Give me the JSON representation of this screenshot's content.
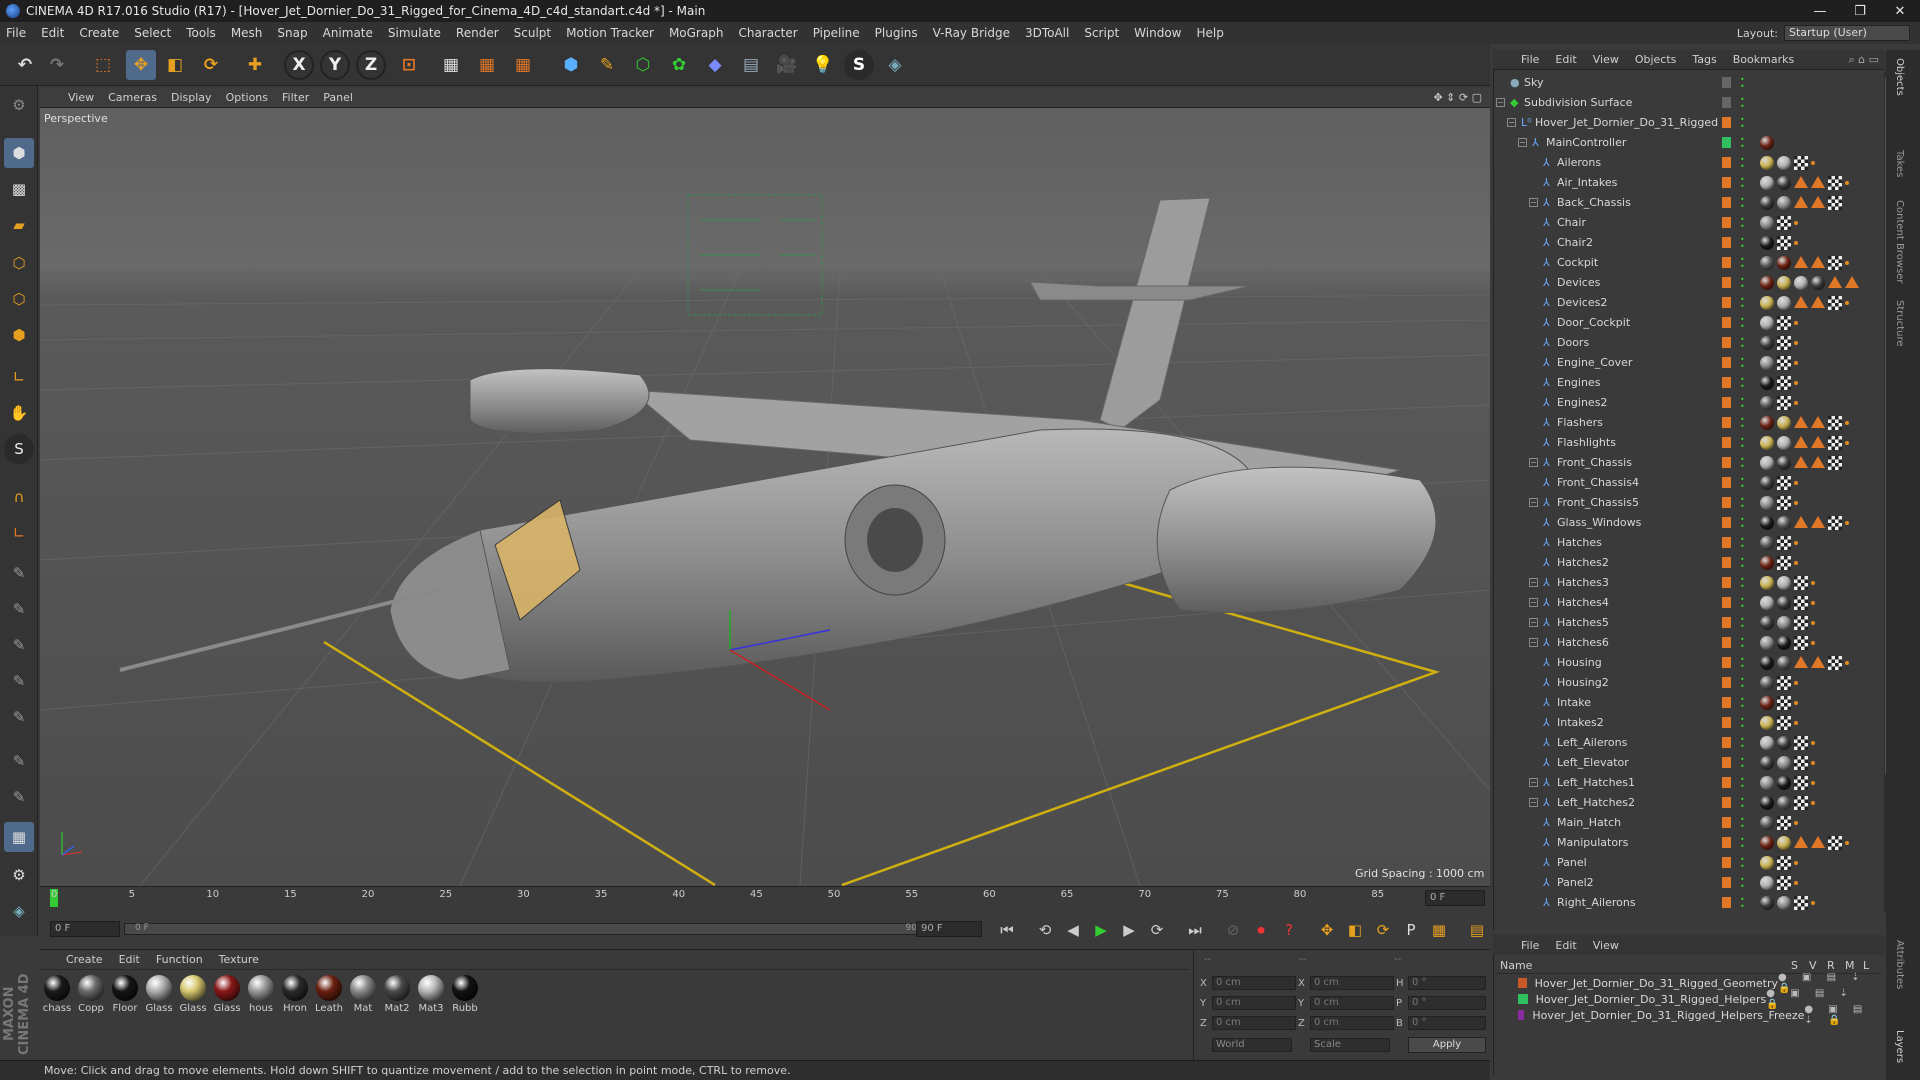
{
  "window": {
    "title": "CINEMA 4D R17.016 Studio (R17) - [Hover_Jet_Dornier_Do_31_Rigged_for_Cinema_4D_c4d_standart.c4d *] - Main"
  },
  "menubar": {
    "items": [
      "File",
      "Edit",
      "Create",
      "Select",
      "Tools",
      "Mesh",
      "Snap",
      "Animate",
      "Simulate",
      "Render",
      "Sculpt",
      "Motion Tracker",
      "MoGraph",
      "Character",
      "Pipeline",
      "Plugins",
      "V-Ray Bridge",
      "3DToAll",
      "Script",
      "Window",
      "Help"
    ],
    "layout_label": "Layout:",
    "layout_value": "Startup (User)"
  },
  "viewport": {
    "menu": [
      "View",
      "Cameras",
      "Display",
      "Options",
      "Filter",
      "Panel"
    ],
    "label": "Perspective",
    "grid_spacing": "Grid Spacing : 1000 cm"
  },
  "timeline": {
    "ticks": [
      "0",
      "5",
      "10",
      "15",
      "20",
      "25",
      "30",
      "35",
      "40",
      "45",
      "50",
      "55",
      "60",
      "65",
      "70",
      "75",
      "80",
      "85",
      "90"
    ],
    "end_frame": "0 F"
  },
  "transport": {
    "start": "0 F",
    "range_start": "0 F",
    "range_end": "90 F",
    "end": "90 F"
  },
  "materials": {
    "menu": [
      "Create",
      "Edit",
      "Function",
      "Texture"
    ],
    "items": [
      {
        "label": "chass",
        "color": "#1a1a1a"
      },
      {
        "label": "Copp",
        "color": "#6a6a6a"
      },
      {
        "label": "Floor",
        "color": "#151515"
      },
      {
        "label": "Glass",
        "color": "#b0b0b0"
      },
      {
        "label": "Glass",
        "color": "#d8c870"
      },
      {
        "label": "Glass",
        "color": "#8a1818"
      },
      {
        "label": "hous",
        "color": "#9a9a9a"
      },
      {
        "label": "Hron",
        "color": "#2a2a2a"
      },
      {
        "label": "Leath",
        "color": "#6a2010"
      },
      {
        "label": "Mat",
        "color": "#8a8a8a"
      },
      {
        "label": "Mat2",
        "color": "#4a4a4a"
      },
      {
        "label": "Mat3",
        "color": "#b8b8b8"
      },
      {
        "label": "Rubb",
        "color": "#111111"
      }
    ]
  },
  "coords": {
    "x_pos": "0 cm",
    "y_pos": "0 cm",
    "z_pos": "0 cm",
    "x_size": "0 cm",
    "y_size": "0 cm",
    "z_size": "0 cm",
    "h_rot": "0 °",
    "p_rot": "0 °",
    "b_rot": "0 °",
    "mode1": "World",
    "mode2": "Scale",
    "apply": "Apply",
    "lbl_x": "X",
    "lbl_y": "Y",
    "lbl_z": "Z",
    "lbl_h": "H",
    "lbl_p": "P",
    "lbl_b": "B",
    "top1": "--",
    "top2": "--",
    "top3": "--"
  },
  "status": "Move: Click and drag to move elements. Hold down SHIFT to quantize movement / add to the selection in point mode, CTRL to remove.",
  "object_manager": {
    "menu": [
      "File",
      "Edit",
      "View",
      "Objects",
      "Tags",
      "Bookmarks"
    ],
    "objects": [
      {
        "name": "Sky",
        "indent": 0,
        "expand": false,
        "icon": "sky"
      },
      {
        "name": "Subdivision Surface",
        "indent": 0,
        "expand": true,
        "icon": "subd"
      },
      {
        "name": "Hover_Jet_Dornier_Do_31_Rigged",
        "indent": 1,
        "expand": true,
        "icon": "null"
      },
      {
        "name": "MainController",
        "indent": 2,
        "expand": true,
        "icon": "bone"
      },
      {
        "name": "Ailerons",
        "indent": 3,
        "expand": false,
        "icon": "bone"
      },
      {
        "name": "Air_Intakes",
        "indent": 3,
        "expand": false,
        "icon": "bone"
      },
      {
        "name": "Back_Chassis",
        "indent": 3,
        "expand": true,
        "icon": "bone"
      },
      {
        "name": "Chair",
        "indent": 3,
        "expand": false,
        "icon": "bone"
      },
      {
        "name": "Chair2",
        "indent": 3,
        "expand": false,
        "icon": "bone"
      },
      {
        "name": "Cockpit",
        "indent": 3,
        "expand": false,
        "icon": "bone"
      },
      {
        "name": "Devices",
        "indent": 3,
        "expand": false,
        "icon": "bone"
      },
      {
        "name": "Devices2",
        "indent": 3,
        "expand": false,
        "icon": "bone"
      },
      {
        "name": "Door_Cockpit",
        "indent": 3,
        "expand": false,
        "icon": "bone"
      },
      {
        "name": "Doors",
        "indent": 3,
        "expand": false,
        "icon": "bone"
      },
      {
        "name": "Engine_Cover",
        "indent": 3,
        "expand": false,
        "icon": "bone"
      },
      {
        "name": "Engines",
        "indent": 3,
        "expand": false,
        "icon": "bone"
      },
      {
        "name": "Engines2",
        "indent": 3,
        "expand": false,
        "icon": "bone"
      },
      {
        "name": "Flashers",
        "indent": 3,
        "expand": false,
        "icon": "bone"
      },
      {
        "name": "Flashlights",
        "indent": 3,
        "expand": false,
        "icon": "bone"
      },
      {
        "name": "Front_Chassis",
        "indent": 3,
        "expand": true,
        "icon": "bone"
      },
      {
        "name": "Front_Chassis4",
        "indent": 3,
        "expand": false,
        "icon": "bone"
      },
      {
        "name": "Front_Chassis5",
        "indent": 3,
        "expand": true,
        "icon": "bone"
      },
      {
        "name": "Glass_Windows",
        "indent": 3,
        "expand": false,
        "icon": "bone"
      },
      {
        "name": "Hatches",
        "indent": 3,
        "expand": false,
        "icon": "bone"
      },
      {
        "name": "Hatches2",
        "indent": 3,
        "expand": false,
        "icon": "bone"
      },
      {
        "name": "Hatches3",
        "indent": 3,
        "expand": true,
        "icon": "bone"
      },
      {
        "name": "Hatches4",
        "indent": 3,
        "expand": true,
        "icon": "bone"
      },
      {
        "name": "Hatches5",
        "indent": 3,
        "expand": true,
        "icon": "bone"
      },
      {
        "name": "Hatches6",
        "indent": 3,
        "expand": true,
        "icon": "bone"
      },
      {
        "name": "Housing",
        "indent": 3,
        "expand": false,
        "icon": "bone"
      },
      {
        "name": "Housing2",
        "indent": 3,
        "expand": false,
        "icon": "bone"
      },
      {
        "name": "Intake",
        "indent": 3,
        "expand": false,
        "icon": "bone"
      },
      {
        "name": "Intakes2",
        "indent": 3,
        "expand": false,
        "icon": "bone"
      },
      {
        "name": "Left_Ailerons",
        "indent": 3,
        "expand": false,
        "icon": "bone"
      },
      {
        "name": "Left_Elevator",
        "indent": 3,
        "expand": false,
        "icon": "bone"
      },
      {
        "name": "Left_Hatches1",
        "indent": 3,
        "expand": true,
        "icon": "bone"
      },
      {
        "name": "Left_Hatches2",
        "indent": 3,
        "expand": true,
        "icon": "bone"
      },
      {
        "name": "Main_Hatch",
        "indent": 3,
        "expand": false,
        "icon": "bone"
      },
      {
        "name": "Manipulators",
        "indent": 3,
        "expand": false,
        "icon": "bone"
      },
      {
        "name": "Panel",
        "indent": 3,
        "expand": false,
        "icon": "bone"
      },
      {
        "name": "Panel2",
        "indent": 3,
        "expand": false,
        "icon": "bone"
      },
      {
        "name": "Right_Ailerons",
        "indent": 3,
        "expand": false,
        "icon": "bone"
      }
    ]
  },
  "layer_manager": {
    "menu": [
      "File",
      "Edit",
      "View"
    ],
    "header": {
      "name": "Name",
      "s": "S",
      "v": "V",
      "r": "R",
      "m": "M",
      "l": "L"
    },
    "layers": [
      {
        "name": "Hover_Jet_Dornier_Do_31_Rigged_Geometry",
        "color": "#c85a28"
      },
      {
        "name": "Hover_Jet_Dornier_Do_31_Rigged_Helpers",
        "color": "#30c060"
      },
      {
        "name": "Hover_Jet_Dornier_Do_31_Rigged_Helpers_Freeze",
        "color": "#8a2ca0"
      }
    ]
  },
  "right_tabs": [
    "Objects",
    "Takes",
    "Content Browser",
    "Structure",
    "Attributes",
    "Layers"
  ],
  "maxon": "MAXON CINEMA 4D"
}
